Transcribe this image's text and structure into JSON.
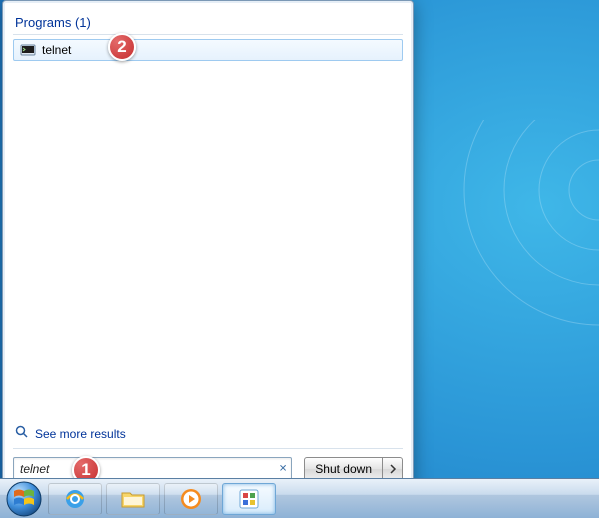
{
  "section": {
    "programs_header": "Programs (1)"
  },
  "results": [
    {
      "label": "telnet"
    }
  ],
  "see_more": {
    "label": "See more results"
  },
  "search": {
    "value": "telnet"
  },
  "shutdown": {
    "label": "Shut down"
  },
  "callouts": {
    "one": "1",
    "two": "2"
  }
}
